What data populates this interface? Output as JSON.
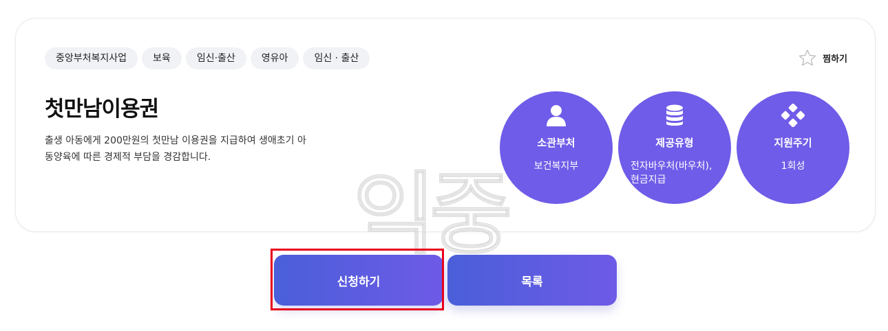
{
  "tags": [
    "중앙부처복지사업",
    "보육",
    "임신·출산",
    "영유아",
    "임신 · 출산"
  ],
  "favorite": {
    "label": "찜하기",
    "icon": "star-icon"
  },
  "title": "첫만남이용권",
  "description": "출생 아동에게 200만원의 첫만남 이용권을 지급하여 생애초기 아동양육에 따른 경제적 부담을 경감합니다.",
  "watermark": "익중",
  "info": [
    {
      "label": "소관부처",
      "value": "보건복지부",
      "icon": "person-icon"
    },
    {
      "label": "제공유형",
      "value": "전자바우처(바우처), 현금지급",
      "icon": "database-icon"
    },
    {
      "label": "지원주기",
      "value": "1회성",
      "icon": "dots-icon"
    }
  ],
  "buttons": {
    "apply": "신청하기",
    "list": "목록"
  },
  "colors": {
    "accent": "#6f5ce8",
    "button_start": "#4a5fd9",
    "button_end": "#6e5ae6",
    "highlight": "#e8001c"
  }
}
